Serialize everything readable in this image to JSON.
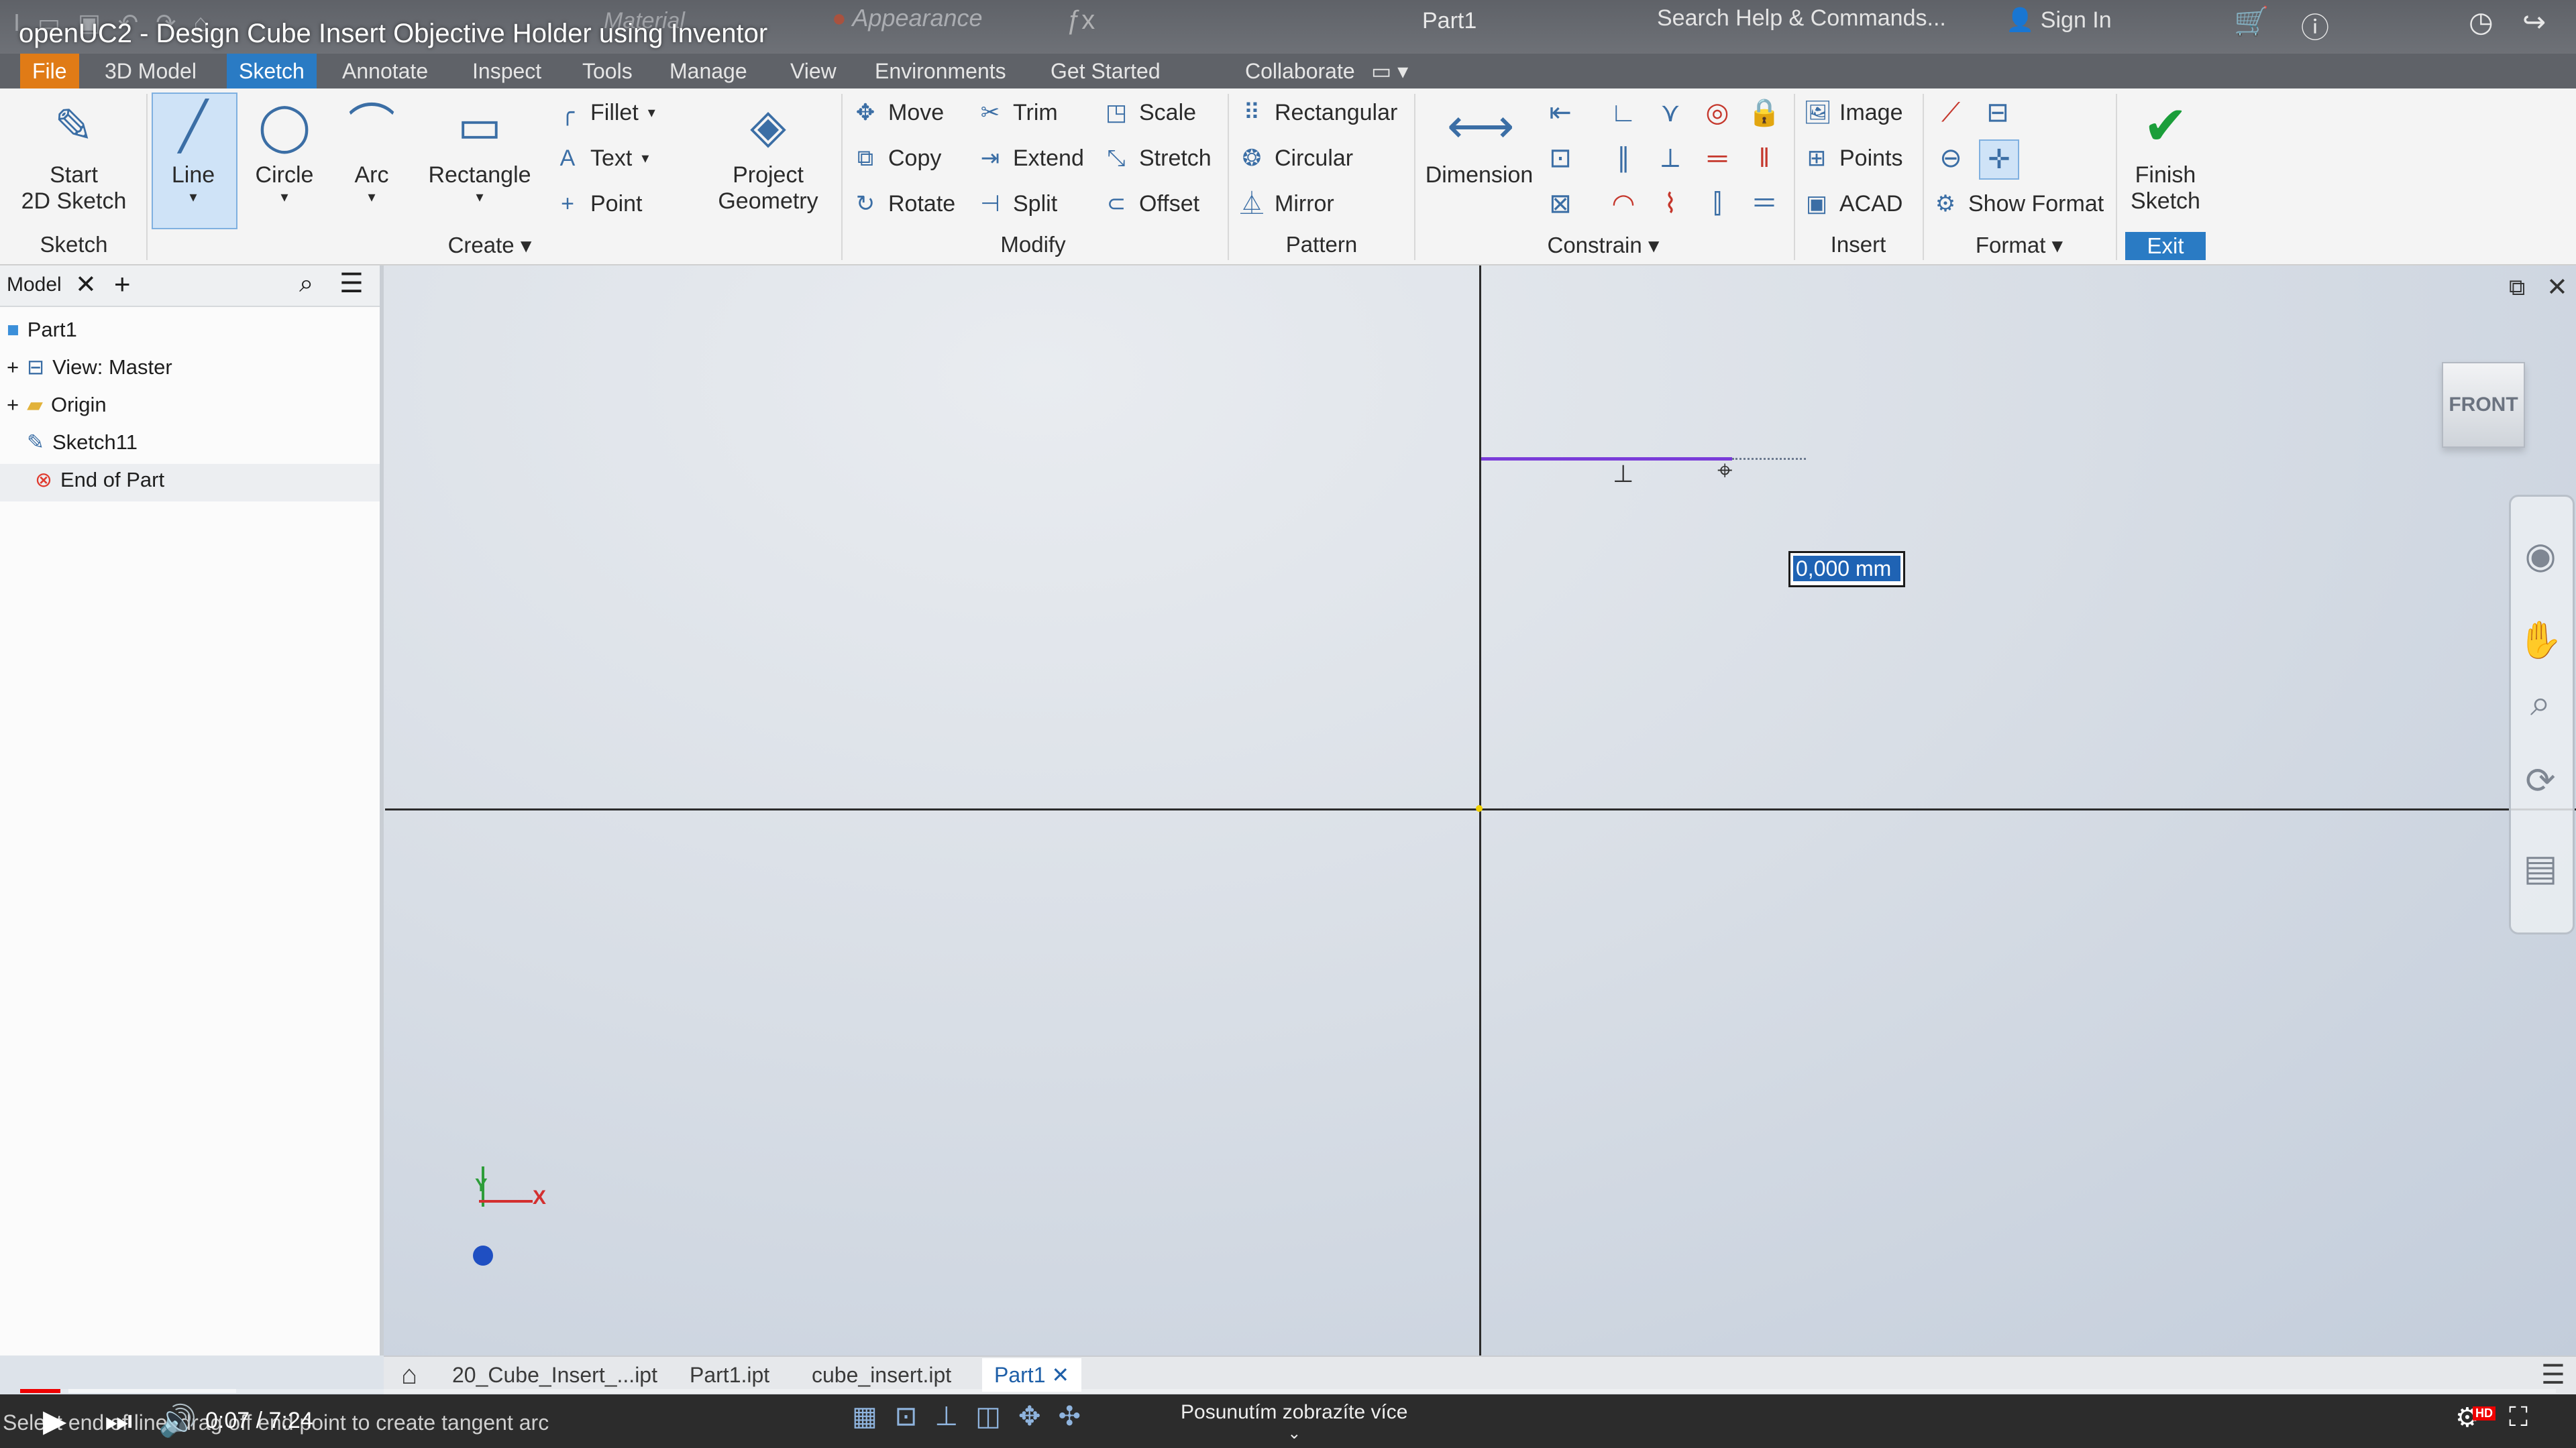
{
  "video": {
    "title": "openUC2 - Design Cube Insert Objective Holder using Inventor",
    "time": "0:07 / 7:24",
    "progress_fraction": 0.016,
    "overlay_hint": "Posunutím zobrazíte více",
    "hd_badge": "HD"
  },
  "titlebar": {
    "appearance": "Appearance",
    "material": "Material",
    "document": "Part1",
    "search_placeholder": "Search Help & Commands...",
    "sign_in": "Sign In"
  },
  "menu_tabs": [
    "File",
    "3D Model",
    "Sketch",
    "Annotate",
    "Inspect",
    "Tools",
    "Manage",
    "View",
    "Environments",
    "Get Started",
    "Collaborate"
  ],
  "active_tab": "Sketch",
  "ribbon": {
    "sketch": {
      "start_line1": "Start",
      "start_line2": "2D Sketch",
      "panel": "Sketch"
    },
    "create": {
      "line": "Line",
      "circle": "Circle",
      "arc": "Arc",
      "rectangle": "Rectangle",
      "fillet": "Fillet",
      "text": "Text",
      "point": "Point",
      "project1": "Project",
      "project2": "Geometry",
      "panel": "Create"
    },
    "modify": {
      "move": "Move",
      "copy": "Copy",
      "rotate": "Rotate",
      "trim": "Trim",
      "extend": "Extend",
      "split": "Split",
      "scale": "Scale",
      "stretch": "Stretch",
      "offset": "Offset",
      "panel": "Modify"
    },
    "pattern": {
      "rectangular": "Rectangular",
      "circular": "Circular",
      "mirror": "Mirror",
      "panel": "Pattern"
    },
    "constrain": {
      "dimension": "Dimension",
      "panel": "Constrain"
    },
    "insert": {
      "image": "Image",
      "points": "Points",
      "acad": "ACAD",
      "panel": "Insert"
    },
    "format": {
      "show_format": "Show Format",
      "panel": "Format"
    },
    "exit": {
      "finish1": "Finish",
      "finish2": "Sketch",
      "panel": "Exit"
    }
  },
  "browser": {
    "tab": "Model",
    "items": [
      "Part1",
      "View: Master",
      "Origin",
      "Sketch11",
      "End of Part"
    ]
  },
  "canvas": {
    "dimension_value": "0,000 mm",
    "viewcube": "FRONT",
    "axis_x": "X",
    "axis_y": "Y"
  },
  "doc_tabs": [
    "20_Cube_Insert_...ipt",
    "Part1.ipt",
    "cube_insert.ipt",
    "Part1"
  ],
  "status": {
    "text": "Select end of line, drag off end point to create tangent arc"
  },
  "colors": {
    "accent": "#2a7bc4",
    "file_tab": "#e07b16",
    "sketch_line": "#7a3cd9",
    "progress": "#ee0000"
  }
}
